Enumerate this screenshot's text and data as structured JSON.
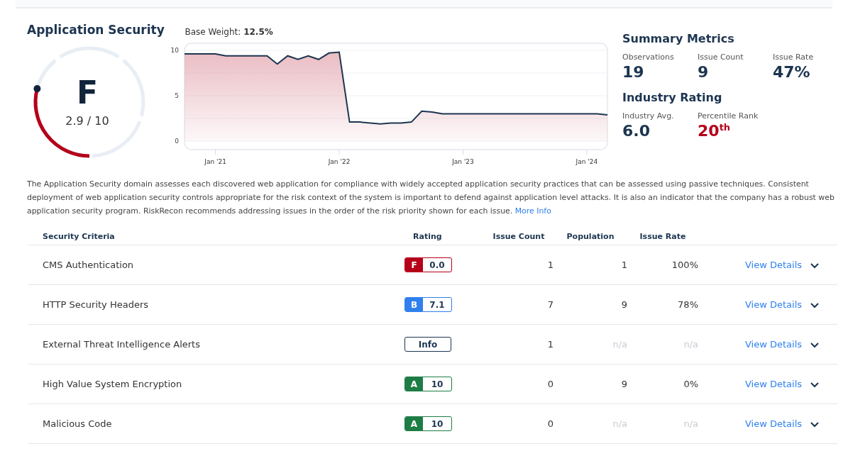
{
  "domain": {
    "title": "Application Security",
    "base_weight_label": "Base Weight:",
    "base_weight": "12.5%"
  },
  "gauge": {
    "grade": "F",
    "score": "2.9 / 10",
    "level": 0.29
  },
  "trend": {
    "chart_data": {
      "type": "area",
      "categories": [
        null,
        null,
        null,
        "Jan '21",
        null,
        null,
        null,
        null,
        null,
        null,
        null,
        null,
        null,
        null,
        null,
        "Jan '22",
        null,
        null,
        null,
        null,
        null,
        null,
        null,
        null,
        null,
        null,
        null,
        "Jan '23",
        null,
        null,
        null,
        null,
        null,
        null,
        null,
        null,
        null,
        null,
        null,
        "Jan '24",
        null,
        null
      ],
      "series": [
        {
          "color": "#1d3550",
          "values": [
            9.6,
            9.6,
            9.6,
            9.6,
            9.4,
            9.4,
            9.4,
            9.4,
            9.4,
            8.5,
            9.4,
            9.0,
            9.4,
            9.0,
            9.7,
            9.8,
            2.1,
            2.1,
            2.0,
            1.9,
            2.0,
            2.0,
            2.1,
            3.3,
            3.2,
            3.0,
            3.0,
            3.0,
            3.0,
            3.0,
            3.0,
            3.0,
            3.0,
            3.0,
            3.0,
            3.0,
            3.0,
            3.0,
            3.0,
            3.0,
            3.0,
            2.9
          ]
        }
      ],
      "ylim": [
        0,
        10
      ],
      "yticks": [
        0,
        5,
        10
      ]
    }
  },
  "summary": {
    "title": "Summary Metrics",
    "metrics": [
      {
        "label": "Observations",
        "value": "19",
        "highlight": false
      },
      {
        "label": "Issue Count",
        "value": "9",
        "highlight": false
      },
      {
        "label": "Issue Rate",
        "value": "47%",
        "highlight": false
      }
    ]
  },
  "industry": {
    "title": "Industry Rating",
    "metrics": [
      {
        "label": "Industry Avg.",
        "value": "6.0",
        "highlight": false
      },
      {
        "label": "Percentile Rank",
        "value": "20$^{th}$",
        "highlight": true
      }
    ]
  },
  "description": "The Application Security domain assesses each discovered web application for compliance with widely accepted application security practices that can be assessed using passive techniques. Consistent deployment of web application security controls appropriate for the risk context of the system is important to defend against application level attacks. It is also an indicator that the company has a robust web application security program. RiskRecon recommends addressing issues in the order of the risk priority shown for each issue.",
  "more_info_link": "More Info",
  "table": {
    "columns": [
      "Security Criteria",
      "Rating",
      "Issue Count",
      "Population",
      "Issue Rate"
    ],
    "rows": [
      {
        "criteria": "CMS Authentication",
        "rating": {
          "kind": "grade",
          "grade": "F",
          "score": "0.0",
          "color": "#b5001a"
        },
        "issue_count": "1",
        "population": {
          "text": "1",
          "available": true
        },
        "issue_rate": {
          "text": "100%",
          "available": true
        },
        "link": "View Details",
        "expanded": false
      },
      {
        "criteria": "HTTP Security Headers",
        "rating": {
          "kind": "grade",
          "grade": "B",
          "score": "7.1",
          "color": "#2f80ed"
        },
        "issue_count": "7",
        "population": {
          "text": "9",
          "available": true
        },
        "issue_rate": {
          "text": "78%",
          "available": true
        },
        "link": "View Details",
        "expanded": false
      },
      {
        "criteria": "External Threat Intelligence Alerts",
        "rating": {
          "kind": "info",
          "label": "Info",
          "color": "#1d3550"
        },
        "issue_count": "1",
        "population": {
          "text": "n/a",
          "available": false
        },
        "issue_rate": {
          "text": "n/a",
          "available": false
        },
        "link": "View Details",
        "expanded": false
      },
      {
        "criteria": "High Value System Encryption",
        "rating": {
          "kind": "grade",
          "grade": "A",
          "score": "10",
          "color": "#1e7d45"
        },
        "issue_count": "0",
        "population": {
          "text": "9",
          "available": true
        },
        "issue_rate": {
          "text": "0%",
          "available": true
        },
        "link": "View Details",
        "expanded": false
      },
      {
        "criteria": "Malicious Code",
        "rating": {
          "kind": "grade",
          "grade": "A",
          "score": "10",
          "color": "#1e7d45"
        },
        "issue_count": "0",
        "population": {
          "text": "n/a",
          "available": false
        },
        "issue_rate": {
          "text": "n/a",
          "available": false
        },
        "link": "View Details",
        "expanded": false
      }
    ]
  }
}
